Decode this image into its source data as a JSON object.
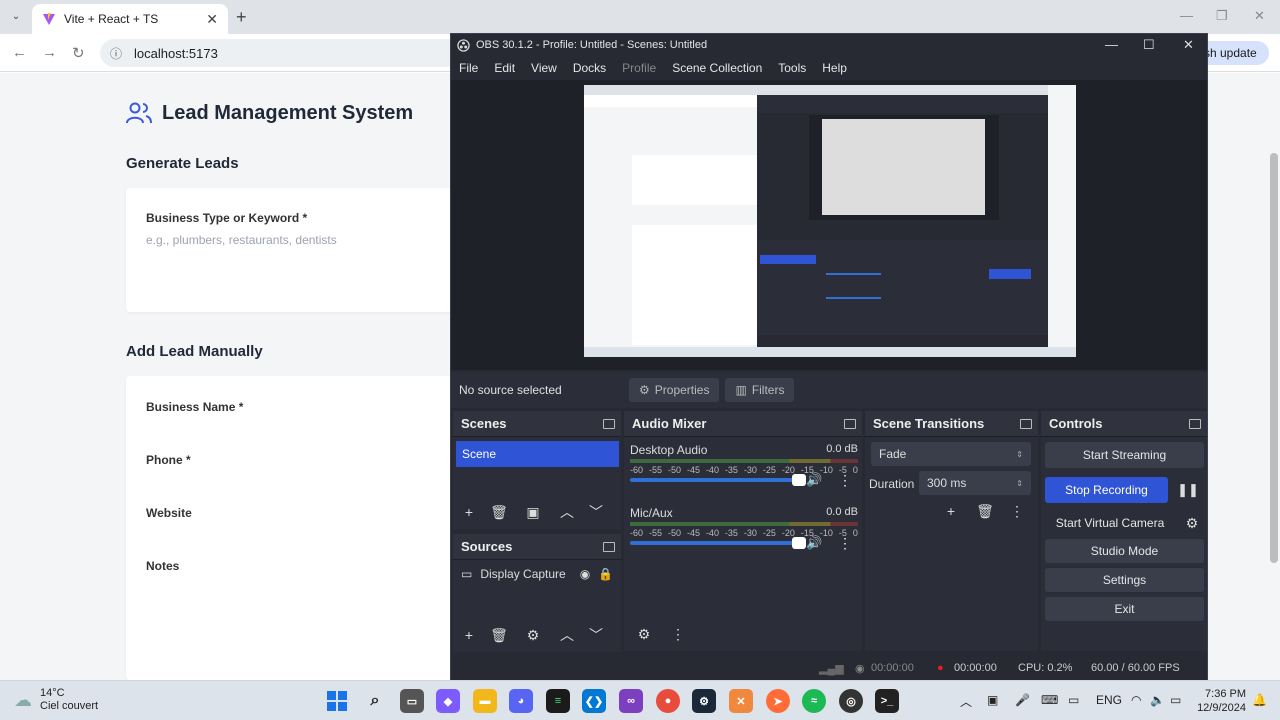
{
  "browser": {
    "tab_title": "Vite + React + TS",
    "url": "localhost:5173",
    "refresh_label": "sh update"
  },
  "app": {
    "title": "Lead Management System",
    "generate": {
      "heading": "Generate Leads",
      "keyword_label": "Business Type or Keyword *",
      "keyword_placeholder": "e.g., plumbers, restaurants, dentists"
    },
    "manual": {
      "heading": "Add Lead Manually",
      "fields": [
        "Business Name *",
        "Phone *",
        "Website",
        "Notes"
      ]
    }
  },
  "obs": {
    "title": "OBS 30.1.2 - Profile: Untitled - Scenes: Untitled",
    "menu": [
      "File",
      "Edit",
      "View",
      "Docks",
      "Profile",
      "Scene Collection",
      "Tools",
      "Help"
    ],
    "no_source": "No source selected",
    "properties_label": "Properties",
    "filters_label": "Filters",
    "scenes": {
      "title": "Scenes",
      "items": [
        "Scene"
      ]
    },
    "sources": {
      "title": "Sources",
      "items": [
        "Display Capture"
      ]
    },
    "mixer": {
      "title": "Audio Mixer",
      "ticks": [
        "-60",
        "-55",
        "-50",
        "-45",
        "-40",
        "-35",
        "-30",
        "-25",
        "-20",
        "-15",
        "-10",
        "-5",
        "0"
      ],
      "channels": [
        {
          "name": "Desktop Audio",
          "db": "0.0 dB",
          "volume": 1.0
        },
        {
          "name": "Mic/Aux",
          "db": "0.0 dB",
          "volume": 1.0
        }
      ]
    },
    "transitions": {
      "title": "Scene Transitions",
      "selected": "Fade",
      "duration_label": "Duration",
      "duration_value": "300 ms"
    },
    "controls": {
      "title": "Controls",
      "start_streaming": "Start Streaming",
      "stop_recording": "Stop Recording",
      "start_virtual_camera": "Start Virtual Camera",
      "studio_mode": "Studio Mode",
      "settings": "Settings",
      "exit": "Exit"
    },
    "status": {
      "stream_time": "00:00:00",
      "rec_time": "00:00:00",
      "cpu": "CPU: 0.2%",
      "fps": "60.00 / 60.00 FPS"
    }
  },
  "taskbar": {
    "temp": "14°C",
    "weather": "Ciel couvert",
    "lang": "ENG",
    "time": "7:36 PM",
    "date": "12/9/2024"
  }
}
